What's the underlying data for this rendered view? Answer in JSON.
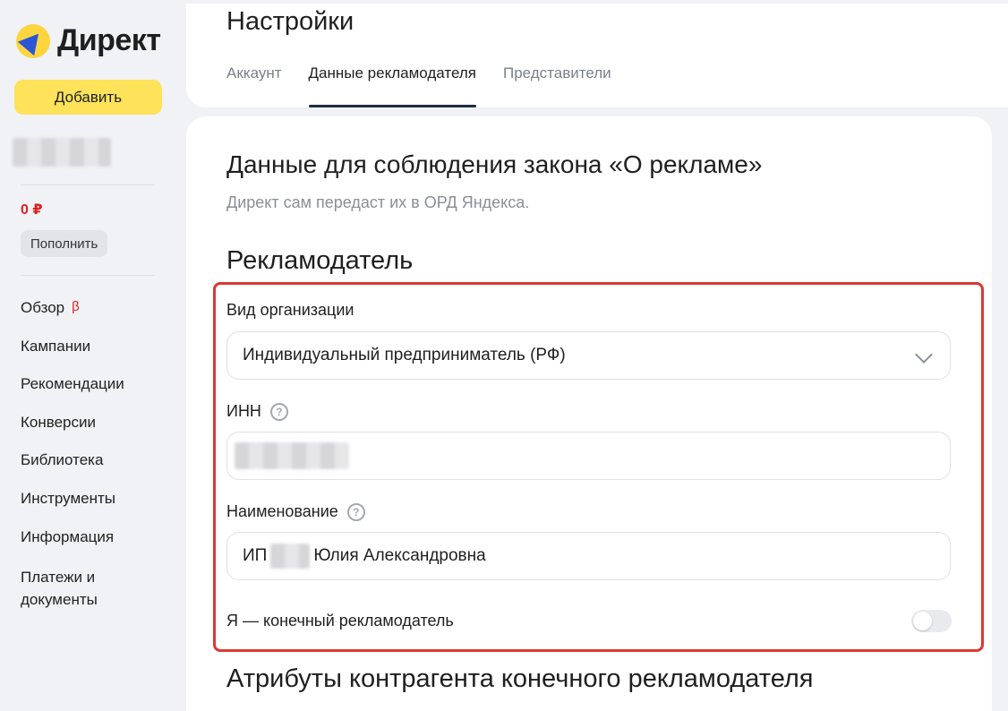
{
  "sidebar": {
    "logo_text": "Директ",
    "add_label": "Добавить",
    "balance": "0 ₽",
    "topup_label": "Пополнить",
    "beta_mark": "β",
    "nav": [
      {
        "label": "Обзор"
      },
      {
        "label": "Кампании"
      },
      {
        "label": "Рекомендации"
      },
      {
        "label": "Конверсии"
      },
      {
        "label": "Библиотека"
      },
      {
        "label": "Инструменты"
      },
      {
        "label": "Информация"
      },
      {
        "label": "Платежи и документы"
      }
    ]
  },
  "header": {
    "title": "Настройки",
    "tabs": [
      {
        "label": "Аккаунт"
      },
      {
        "label": "Данные рекламодателя"
      },
      {
        "label": "Представители"
      }
    ]
  },
  "content": {
    "law_title": "Данные для соблюдения закона «О рекламе»",
    "law_subtitle": "Директ сам передаст их в ОРД Яндекса.",
    "advertiser_title": "Рекламодатель",
    "org_type_label": "Вид организации",
    "org_type_value": "Индивидуальный предприниматель (РФ)",
    "inn_label": "ИНН",
    "name_label": "Наименование",
    "name_prefix": "ИП",
    "name_suffix": "Юлия Александровна",
    "end_advertiser_label": "Я — конечный рекламодатель",
    "attributes_title": "Атрибуты контрагента конечного рекламодателя"
  },
  "icons": {
    "help": "question-circle-icon",
    "select": "chevron-down-icon",
    "logo": "direct-logo-icon"
  },
  "colors": {
    "accent_yellow": "#fde25a",
    "balance_red": "#e02020",
    "highlight_red": "#d83a32",
    "tab_underline": "#1f2a44"
  }
}
